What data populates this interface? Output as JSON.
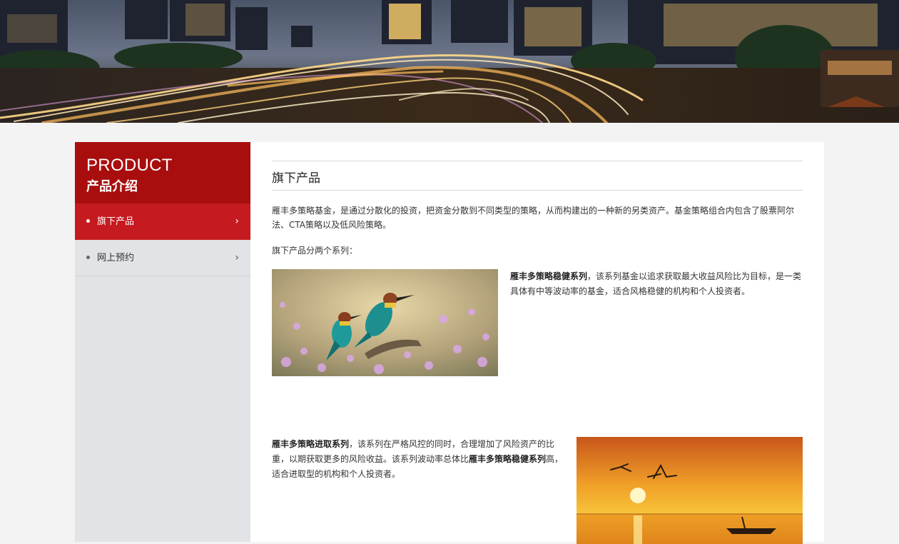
{
  "colors": {
    "accent_dark": "#a80e0e",
    "accent": "#c51a1f",
    "sidebar_bg": "#e1e3e6",
    "page_bg": "#f3f3f3"
  },
  "sidebar": {
    "title_en": "PRODUCT",
    "title_cn": "产品介绍",
    "items": [
      {
        "label": "旗下产品",
        "active": true,
        "icon": "chevron-right-icon"
      },
      {
        "label": "网上预约",
        "active": false,
        "icon": "chevron-right-icon"
      }
    ]
  },
  "main": {
    "title": "旗下产品",
    "intro": "雁丰多策略基金，是通过分散化的投资，把资金分散到不同类型的策略，从而构建出的一种新的另类资产。基金策略组合内包含了股票阿尔法、CTA策略以及低风险策略。",
    "series_intro": "旗下产品分两个系列：",
    "series": [
      {
        "name": "雁丰多策略稳健系列",
        "desc": "，该系列基金以追求获取最大收益风险比为目标，是一类具体有中等波动率的基金，适合风格稳健的机构和个人投资者。",
        "image": "birds-on-flowers-photo"
      },
      {
        "name": "雁丰多策略进取系列",
        "desc_a": "，该系列在严格风控的同时，合理增加了风险资产的比重，以期获取更多的风险收益。该系列波动率总体比",
        "ref": "雁丰多策略稳健系列",
        "desc_b": "高，适合进取型的机构和个人投资者。",
        "image": "sunset-cranes-photo"
      }
    ]
  }
}
